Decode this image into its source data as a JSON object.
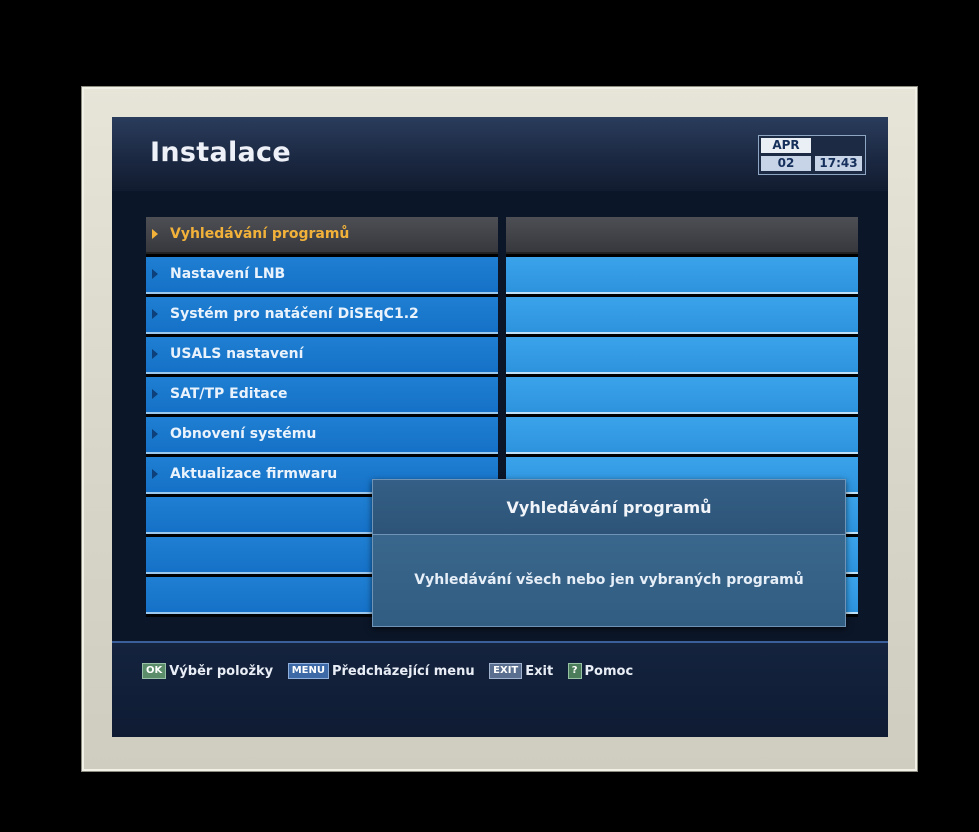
{
  "header": {
    "title": "Instalace",
    "date_month": "APR",
    "date_day": "02",
    "time": "17:43"
  },
  "menu": {
    "items": [
      {
        "label": "Vyhledávání programů",
        "selected": true
      },
      {
        "label": "Nastavení LNB"
      },
      {
        "label": "Systém pro natáčení DiSEqC1.2"
      },
      {
        "label": "USALS nastavení"
      },
      {
        "label": "SAT/TP Editace"
      },
      {
        "label": "Obnovení systému"
      },
      {
        "label": "Aktualizace firmwaru"
      }
    ]
  },
  "popup": {
    "title": "Vyhledávání programů",
    "text": "Vyhledávání všech nebo jen vybraných programů"
  },
  "footer": {
    "ok_key": "OK",
    "ok_text": "Výběr položky",
    "menu_key": "MENU",
    "menu_text": "Předcházející menu",
    "exit_key": "EXIT",
    "exit_text": "Exit",
    "help_key": "?",
    "help_text": "Pomoc"
  },
  "colors": {
    "accent_selected": "#f2b23a",
    "menu_row": "#1f7fd2",
    "background": "#0b1628"
  }
}
